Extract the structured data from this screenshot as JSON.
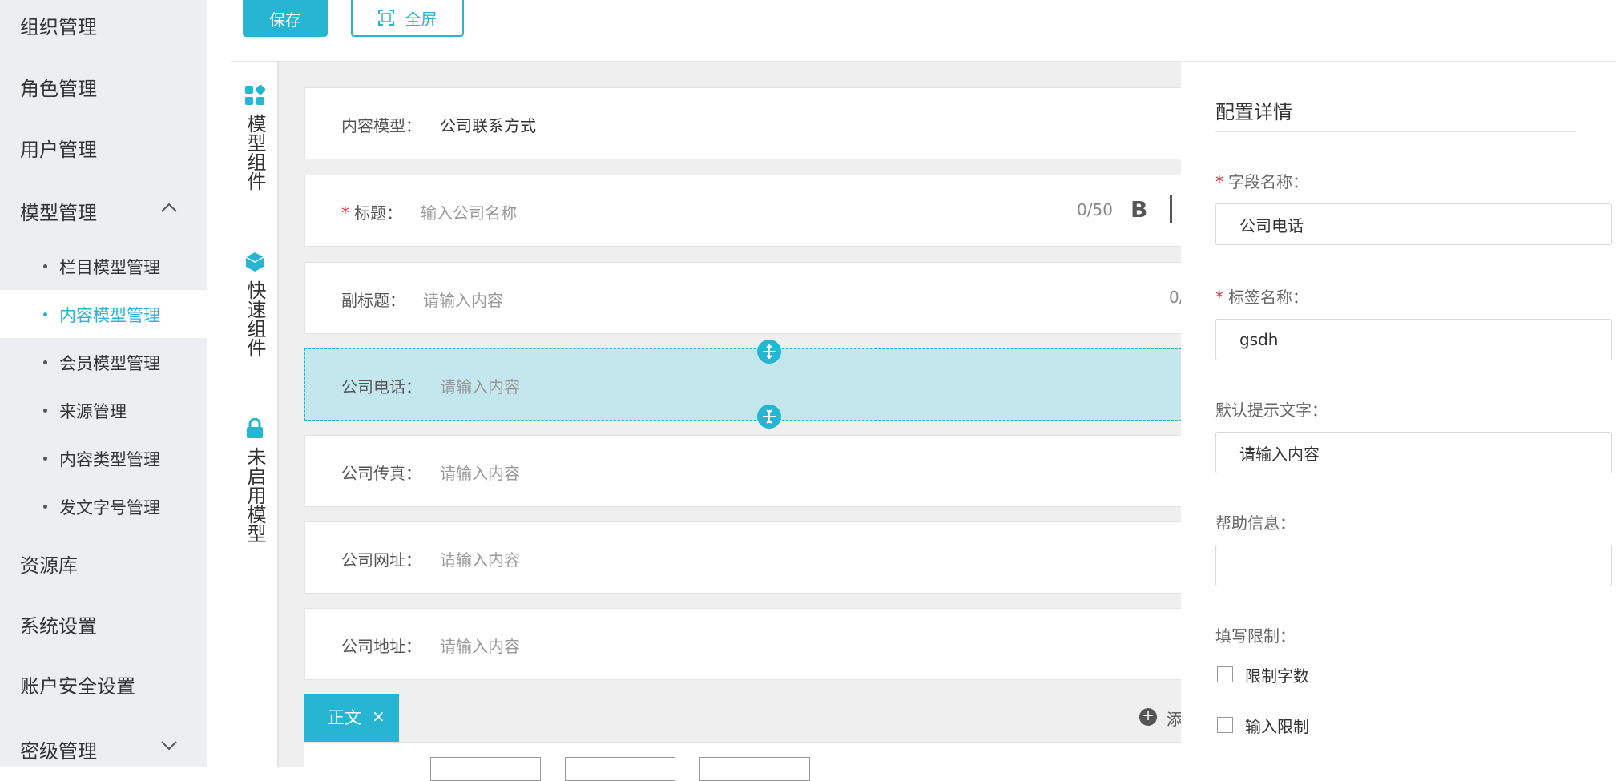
{
  "sidebar": {
    "items": [
      {
        "label": "组织管理"
      },
      {
        "label": "角色管理"
      },
      {
        "label": "用户管理"
      },
      {
        "label": "模型管理"
      },
      {
        "label": "资源库"
      },
      {
        "label": "系统设置"
      },
      {
        "label": "账户安全设置"
      },
      {
        "label": "密级管理"
      }
    ],
    "sub_items": [
      {
        "label": "栏目模型管理"
      },
      {
        "label": "内容模型管理"
      },
      {
        "label": "会员模型管理"
      },
      {
        "label": "来源管理"
      },
      {
        "label": "内容类型管理"
      },
      {
        "label": "发文字号管理"
      }
    ],
    "active_sub_item": "内容模型管理"
  },
  "toolbar": {
    "save_label": "保存",
    "fullscreen_label": "全屏"
  },
  "components": {
    "model": {
      "label": "模型组件",
      "icon": "grid-icon"
    },
    "quick": {
      "label": "快速组件",
      "icon": "cube-icon"
    },
    "disabled": {
      "label": "未启用模型",
      "icon": "lock-icon"
    }
  },
  "canvas": {
    "content_model_label": "内容模型：",
    "content_model_value": "公司联系方式",
    "title_label": "标题：",
    "title_placeholder": "输入公司名称",
    "title_count": "0/50",
    "bold_glyph": "B",
    "subtitle_label": "副标题：",
    "subtitle_placeholder": "请输入内容",
    "subtitle_count": "0/",
    "phone_label": "公司电话：",
    "phone_placeholder": "请输入内容",
    "fax_label": "公司传真：",
    "fax_placeholder": "请输入内容",
    "website_label": "公司网址：",
    "website_placeholder": "请输入内容",
    "address_label": "公司地址：",
    "address_placeholder": "请输入内容",
    "body_tab_label": "正文",
    "body_tab_close": "×",
    "add_label": "添"
  },
  "config": {
    "title": "配置详情",
    "field_name_label": "字段名称：",
    "field_name_value": "公司电话",
    "tag_name_label": "标签名称：",
    "tag_name_value": "gsdh",
    "default_hint_label": "默认提示文字：",
    "default_hint_value": "请输入内容",
    "help_label": "帮助信息：",
    "help_value": "",
    "restriction_label": "填写限制：",
    "limit_chars_label": "限制字数",
    "input_limit_label": "输入限制"
  },
  "colors": {
    "accent": "#26b6d4",
    "selected_row": "#c4e7ed",
    "sidebar_bg": "#eceef1",
    "required": "#e5344b"
  }
}
